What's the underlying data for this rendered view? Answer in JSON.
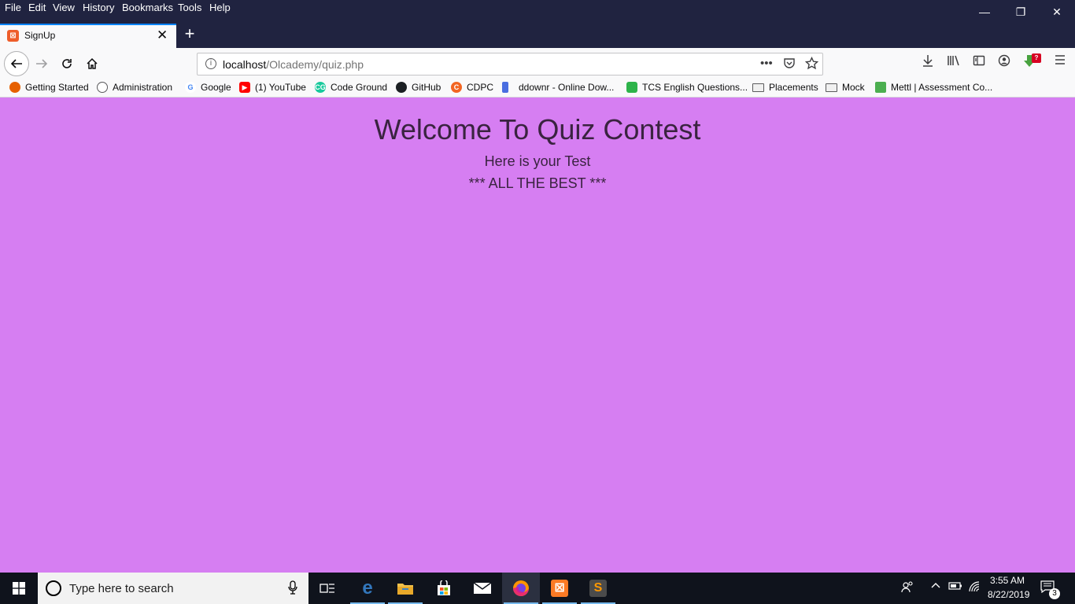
{
  "menubar": {
    "items": [
      "File",
      "Edit",
      "View",
      "History",
      "Bookmarks",
      "Tools",
      "Help"
    ]
  },
  "window_controls": {
    "minimize": "—",
    "restore": "❐",
    "close": "✕"
  },
  "tab": {
    "title": "SignUp",
    "close": "✕",
    "new_tab": "+"
  },
  "nav": {
    "url_host": "localhost",
    "url_path": "/Olcademy/quiz.php",
    "more": "•••",
    "ext_badge": "?"
  },
  "bookmarks": [
    {
      "label": "Getting Started",
      "icon_color": "#e66000"
    },
    {
      "label": "Administration",
      "icon_color": "#5a5a5c"
    },
    {
      "label": "Google",
      "icon_color": "#4285f4"
    },
    {
      "label": "(1) YouTube",
      "icon_color": "#ff0000"
    },
    {
      "label": "Code Ground",
      "icon_color": "#18c99c"
    },
    {
      "label": "GitHub",
      "icon_color": "#1b1f23"
    },
    {
      "label": "CDPC",
      "icon_color": "#f26522"
    },
    {
      "label": "ddownr - Online Dow...",
      "icon_color": "#4a6ee0"
    },
    {
      "label": "TCS English Questions...",
      "icon_color": "#2db34a"
    },
    {
      "label": "Placements",
      "icon_color": "folder"
    },
    {
      "label": "Mock",
      "icon_color": "folder"
    },
    {
      "label": "Mettl | Assessment Co...",
      "icon_color": "#4caf50"
    }
  ],
  "page": {
    "title": "Welcome To Quiz Contest",
    "subtitle": "Here is your Test",
    "wish": "*** ALL THE BEST ***",
    "background": "#d67ef2"
  },
  "taskbar": {
    "search_placeholder": "Type here to search",
    "time": "3:55 AM",
    "date": "8/22/2019",
    "notification_count": "3"
  }
}
